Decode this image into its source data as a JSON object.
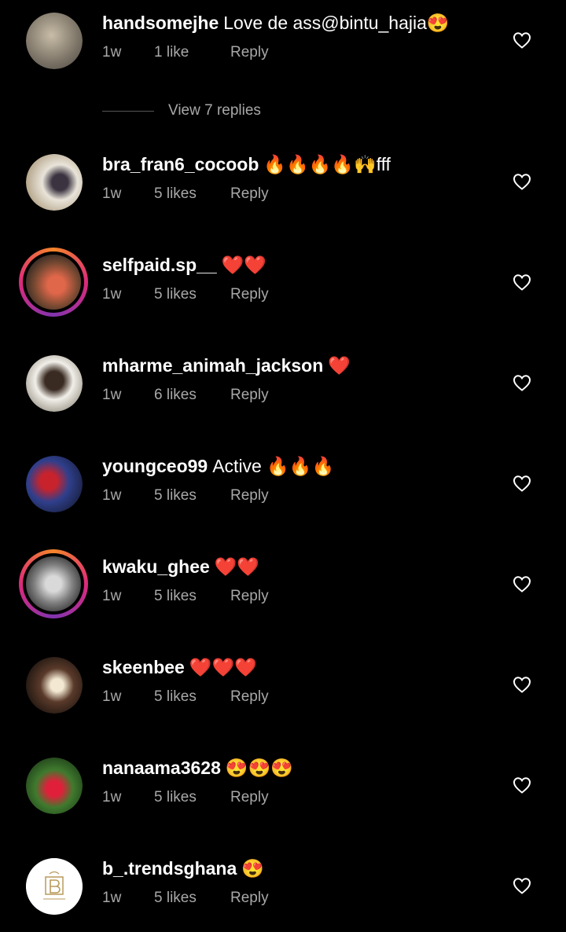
{
  "comments": [
    {
      "username": "handsomejhe",
      "text": "Love de ass@bintu_hajia😍",
      "time": "1w",
      "likes": "1 like",
      "reply": "Reply"
    },
    {
      "username": "bra_fran6_cocoob",
      "text": "🔥🔥🔥🔥🙌fff",
      "time": "1w",
      "likes": "5 likes",
      "reply": "Reply"
    },
    {
      "username": "selfpaid.sp__",
      "text": "❤️❤️",
      "time": "1w",
      "likes": "5 likes",
      "reply": "Reply"
    },
    {
      "username": "mharme_animah_jackson",
      "text": "❤️",
      "time": "1w",
      "likes": "6 likes",
      "reply": "Reply"
    },
    {
      "username": "youngceo99",
      "text": "Active 🔥🔥🔥",
      "time": "1w",
      "likes": "5 likes",
      "reply": "Reply"
    },
    {
      "username": "kwaku_ghee",
      "text": "❤️❤️",
      "time": "1w",
      "likes": "5 likes",
      "reply": "Reply"
    },
    {
      "username": "skeenbee",
      "text": "❤️❤️❤️",
      "time": "1w",
      "likes": "5 likes",
      "reply": "Reply"
    },
    {
      "username": "nanaama3628",
      "text": "😍😍😍",
      "time": "1w",
      "likes": "5 likes",
      "reply": "Reply"
    },
    {
      "username": "b_.trendsghana",
      "text": "😍",
      "time": "1w",
      "likes": "5 likes",
      "reply": "Reply"
    }
  ],
  "view_replies": "View 7 replies",
  "colors": {
    "background": "#000000",
    "meta": "#a8a8a8",
    "story_ring": "#dd2a7b"
  }
}
